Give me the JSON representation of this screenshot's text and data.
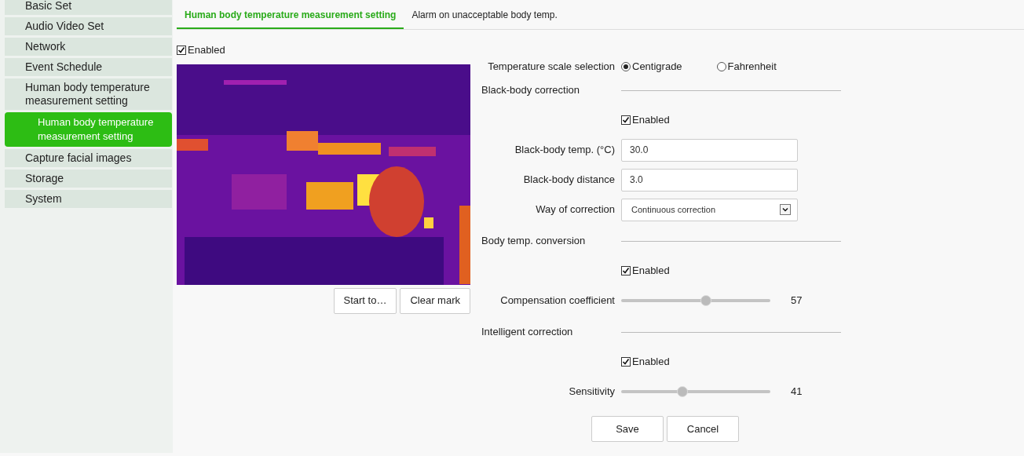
{
  "sidebar": {
    "items": [
      {
        "label": "Basic Set",
        "selected": false
      },
      {
        "label": "Audio Video Set",
        "selected": false
      },
      {
        "label": "Network",
        "selected": false
      },
      {
        "label": "Event Schedule",
        "selected": false
      },
      {
        "label": "Human body temperature measurement setting",
        "selected": false,
        "children": [
          {
            "label": "Human body temperature measurement setting",
            "selected": true
          }
        ]
      },
      {
        "label": "Capture facial images",
        "selected": false
      },
      {
        "label": "Storage",
        "selected": false
      },
      {
        "label": "System",
        "selected": false
      }
    ]
  },
  "tabs": [
    {
      "label": "Human body temperature measurement setting",
      "selected": true
    },
    {
      "label": "Alarm on unacceptable body temp.",
      "selected": false
    }
  ],
  "enabled": {
    "label": "Enabled",
    "checked": true
  },
  "video": {
    "kind": "picture",
    "buttons": [
      "Start to…",
      "Clear mark"
    ]
  },
  "form": {
    "scale": {
      "label": "Temperature scale selection",
      "options": [
        {
          "label": "Centigrade",
          "selected": true
        },
        {
          "label": "Fahrenheit",
          "selected": false
        }
      ]
    },
    "sections": [
      {
        "title": "Black-body correction",
        "rows": [
          {
            "kind": "checkbox",
            "label": "Enabled",
            "checked": true
          },
          {
            "kind": "input",
            "label": "Black-body temp. (°C)",
            "value": "30.0"
          },
          {
            "kind": "input",
            "label": "Black-body distance",
            "value": "3.0"
          },
          {
            "kind": "select",
            "label": "Way of correction",
            "value": "Continuous correction"
          }
        ]
      },
      {
        "title": "Body temp. conversion",
        "rows": [
          {
            "kind": "checkbox",
            "label": "Enabled",
            "checked": true
          },
          {
            "kind": "slider",
            "label": "Compensation coefficient",
            "level": 0.57,
            "reading": "57"
          }
        ]
      },
      {
        "title": "Intelligent correction",
        "rows": [
          {
            "kind": "checkbox",
            "label": "Enabled",
            "checked": true
          },
          {
            "kind": "slider",
            "label": "Sensitivity",
            "level": 0.41,
            "reading": "41"
          }
        ]
      }
    ],
    "buttons": [
      "Save",
      "Cancel"
    ]
  }
}
